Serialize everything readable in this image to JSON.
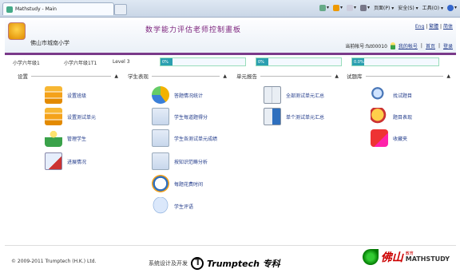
{
  "browser": {
    "tab_title": "Mathstudy - Main",
    "cmd": {
      "page": "页面(P) ▾",
      "safety": "安全(S) ▾",
      "tools": "工具(O) ▾",
      "help": "?"
    }
  },
  "header": {
    "school": "佛山市城南小学",
    "title": "数学能力评估老师控制畫板",
    "links": {
      "eng": "Eng",
      "simp": "繁體",
      "trad": "简体"
    },
    "account_label": "当前帐号:fst00010",
    "my_account": "我的帐号",
    "home": "首页",
    "logout": "登录"
  },
  "classbar": {
    "cls1": "小学六年级1",
    "cls2": "小学六年级1T1",
    "level": "Level 3",
    "progress": [
      {
        "label": "0%",
        "value": 0.0
      },
      {
        "label": "0%",
        "value": 0.0
      },
      {
        "label": "0.0%",
        "value": 0.0
      }
    ]
  },
  "sections": {
    "setup": "设置",
    "performance": "学生表现",
    "unit": "单元报告",
    "bank": "试题库"
  },
  "setup_items": [
    "设置班级",
    "设置测试单元",
    "管理学生",
    "进展情况"
  ],
  "perf_items": [
    "答题情况统计",
    "学生每道题得分",
    "学生各测试单元成绩",
    "按知识范畴分析",
    "每题花费时间",
    "学生评语"
  ],
  "unit_items": [
    "全部测试单元汇总",
    "单个测试单元汇总"
  ],
  "bank_items": [
    "找试题目",
    "题目表现",
    "收藏夹"
  ],
  "footer": {
    "copyright": "© 2009-2011 Trumptech (H.K.) Ltd.",
    "dev": "系统设计及开发",
    "company": "Trumptech 专科",
    "brand_cn": "佛山",
    "brand_edu": "教育",
    "brand_name": "MATHSTUDY"
  },
  "colors": {
    "accent": "#7a3a8a",
    "link": "#203a8a",
    "progress": "#2a9fb0"
  }
}
